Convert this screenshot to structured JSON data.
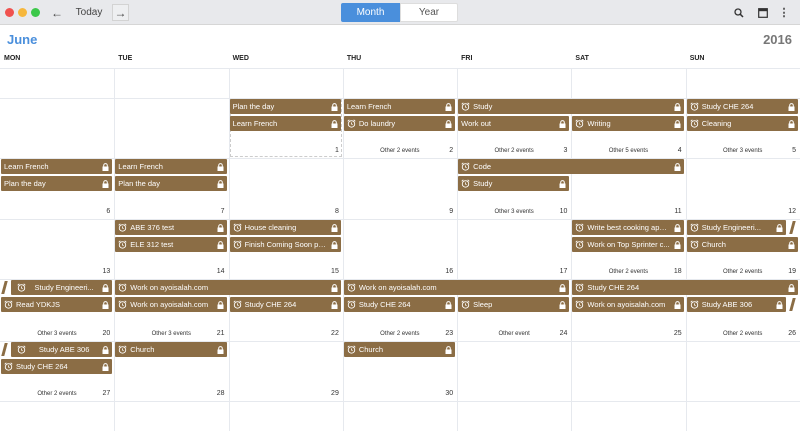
{
  "toolbar": {
    "today_label": "Today",
    "views": [
      "Month",
      "Year"
    ],
    "active_view": "Month"
  },
  "header": {
    "month": "June",
    "year": "2016"
  },
  "weekdays": [
    "MON",
    "TUE",
    "WED",
    "THU",
    "FRI",
    "SAT",
    "SUN"
  ],
  "colors": {
    "event": "#8b6d45",
    "accent": "#4a8fdc"
  },
  "weeks": [
    {
      "days": [
        "",
        "",
        "1",
        "2",
        "3",
        "4",
        "5"
      ],
      "others": [
        "",
        "",
        "",
        "Other 2 events",
        "Other 2 events",
        "Other 5 events",
        "Other 3 events"
      ]
    },
    {
      "days": [
        "6",
        "7",
        "8",
        "9",
        "10",
        "11",
        "12"
      ],
      "others": [
        "",
        "",
        "",
        "",
        "Other 3 events",
        "",
        ""
      ]
    },
    {
      "days": [
        "13",
        "14",
        "15",
        "16",
        "17",
        "18",
        "19"
      ],
      "others": [
        "",
        "",
        "",
        "",
        "",
        "Other 2 events",
        "Other 2 events"
      ]
    },
    {
      "days": [
        "20",
        "21",
        "22",
        "23",
        "24",
        "25",
        "26"
      ],
      "others": [
        "Other 3 events",
        "Other 3 events",
        "",
        "Other 2 events",
        "Other event",
        "",
        "Other 2 events"
      ]
    },
    {
      "days": [
        "27",
        "28",
        "29",
        "30",
        "",
        "",
        ""
      ],
      "others": [
        "Other 2 events",
        "",
        "",
        "",
        "",
        "",
        ""
      ]
    }
  ],
  "events": [
    {
      "week": 0,
      "col": 2,
      "span": 1,
      "lane": 0,
      "title": "Plan the day",
      "alarm": false
    },
    {
      "week": 0,
      "col": 2,
      "span": 1,
      "lane": 1,
      "title": "Learn French",
      "alarm": false
    },
    {
      "week": 0,
      "col": 3,
      "span": 1,
      "lane": 0,
      "title": "Learn French",
      "alarm": false
    },
    {
      "week": 0,
      "col": 3,
      "span": 1,
      "lane": 1,
      "title": "Do laundry",
      "alarm": true
    },
    {
      "week": 0,
      "col": 4,
      "span": 2,
      "lane": 0,
      "title": "Study",
      "alarm": true
    },
    {
      "week": 0,
      "col": 4,
      "span": 1,
      "lane": 1,
      "title": "Work out",
      "alarm": false
    },
    {
      "week": 0,
      "col": 5,
      "span": 1,
      "lane": 1,
      "title": "Writing",
      "alarm": true
    },
    {
      "week": 0,
      "col": 6,
      "span": 1,
      "lane": 0,
      "title": "Study CHE 264",
      "alarm": true
    },
    {
      "week": 0,
      "col": 6,
      "span": 1,
      "lane": 1,
      "title": "Cleaning",
      "alarm": true
    },
    {
      "week": 1,
      "col": 0,
      "span": 1,
      "lane": 0,
      "title": "Learn French",
      "alarm": false
    },
    {
      "week": 1,
      "col": 0,
      "span": 1,
      "lane": 1,
      "title": "Plan the day",
      "alarm": false
    },
    {
      "week": 1,
      "col": 1,
      "span": 1,
      "lane": 0,
      "title": "Learn French",
      "alarm": false
    },
    {
      "week": 1,
      "col": 1,
      "span": 1,
      "lane": 1,
      "title": "Plan the day",
      "alarm": false
    },
    {
      "week": 1,
      "col": 4,
      "span": 2,
      "lane": 0,
      "title": "Code",
      "alarm": true
    },
    {
      "week": 1,
      "col": 4,
      "span": 1,
      "lane": 1,
      "title": "Study",
      "alarm": true
    },
    {
      "week": 2,
      "col": 1,
      "span": 1,
      "lane": 0,
      "title": "ABE 376 test",
      "alarm": true
    },
    {
      "week": 2,
      "col": 1,
      "span": 1,
      "lane": 1,
      "title": "ELE 312 test",
      "alarm": true
    },
    {
      "week": 2,
      "col": 2,
      "span": 1,
      "lane": 0,
      "title": "House cleaning",
      "alarm": true
    },
    {
      "week": 2,
      "col": 2,
      "span": 1,
      "lane": 1,
      "title": "Finish Coming Soon page",
      "alarm": true
    },
    {
      "week": 2,
      "col": 5,
      "span": 1,
      "lane": 0,
      "title": "Write best cooking apps...",
      "alarm": true
    },
    {
      "week": 2,
      "col": 5,
      "span": 1,
      "lane": 1,
      "title": "Work on Top Sprinter c...",
      "alarm": true
    },
    {
      "week": 2,
      "col": 6,
      "span": 1,
      "lane": 0,
      "title": "Study Engineeri...",
      "alarm": true,
      "cont_right": true
    },
    {
      "week": 2,
      "col": 6,
      "span": 1,
      "lane": 1,
      "title": "Church",
      "alarm": true
    },
    {
      "week": 3,
      "col": 0,
      "span": 1,
      "lane": 0,
      "title": "Study Engineeri...",
      "alarm": true,
      "cont_left": true
    },
    {
      "week": 3,
      "col": 0,
      "span": 1,
      "lane": 1,
      "title": "Read YDKJS",
      "alarm": true
    },
    {
      "week": 3,
      "col": 1,
      "span": 2,
      "lane": 0,
      "title": "Work on ayoisalah.com",
      "alarm": true
    },
    {
      "week": 3,
      "col": 3,
      "span": 2,
      "lane": 0,
      "title": "Work on ayoisalah.com",
      "alarm": true
    },
    {
      "week": 3,
      "col": 5,
      "span": 2,
      "lane": 0,
      "title": "Study CHE 264",
      "alarm": true
    },
    {
      "week": 3,
      "col": 1,
      "span": 1,
      "lane": 1,
      "title": "Work on ayoisalah.com",
      "alarm": true
    },
    {
      "week": 3,
      "col": 2,
      "span": 1,
      "lane": 1,
      "title": "Study CHE 264",
      "alarm": true
    },
    {
      "week": 3,
      "col": 3,
      "span": 1,
      "lane": 1,
      "title": "Study CHE 264",
      "alarm": true
    },
    {
      "week": 3,
      "col": 4,
      "span": 1,
      "lane": 1,
      "title": "Sleep",
      "alarm": true
    },
    {
      "week": 3,
      "col": 5,
      "span": 1,
      "lane": 1,
      "title": "Work on ayoisalah.com",
      "alarm": true
    },
    {
      "week": 3,
      "col": 6,
      "span": 1,
      "lane": 1,
      "title": "Study ABE 306",
      "alarm": true,
      "cont_right": true
    },
    {
      "week": 4,
      "col": 0,
      "span": 1,
      "lane": 0,
      "title": "Study ABE 306",
      "alarm": true,
      "cont_left": true
    },
    {
      "week": 4,
      "col": 0,
      "span": 1,
      "lane": 1,
      "title": "Study CHE 264",
      "alarm": true
    },
    {
      "week": 4,
      "col": 1,
      "span": 1,
      "lane": 0,
      "title": "Church",
      "alarm": true
    },
    {
      "week": 4,
      "col": 3,
      "span": 1,
      "lane": 0,
      "title": "Church",
      "alarm": true
    }
  ]
}
